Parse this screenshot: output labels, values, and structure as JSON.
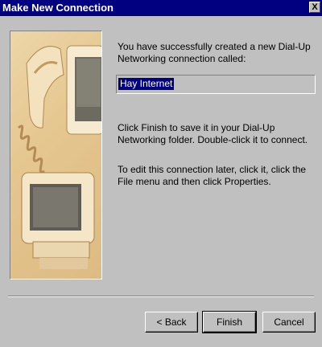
{
  "window": {
    "title": "Make New Connection",
    "close_label": "X"
  },
  "content": {
    "intro": "You have successfully created a new Dial-Up Networking connection called:",
    "connection_name": "Hay Internet",
    "finish_info": "Click Finish to save it in your Dial-Up Networking folder. Double-click it to connect.",
    "edit_info": "To edit this connection later, click it, click the File menu and then click Properties."
  },
  "buttons": {
    "back": "< Back",
    "finish": "Finish",
    "cancel": "Cancel"
  },
  "colors": {
    "titlebar": "#000080",
    "dialog_face": "#c0c0c0",
    "selection": "#000080"
  }
}
